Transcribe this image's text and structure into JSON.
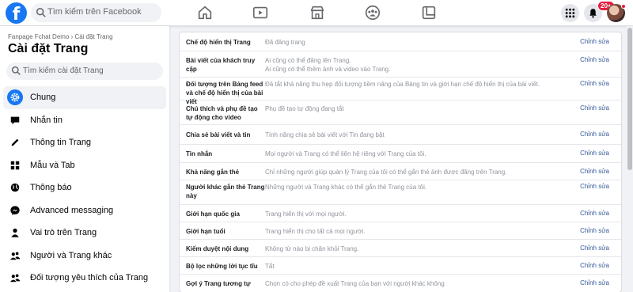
{
  "topbar": {
    "logo": "f",
    "search_placeholder": "Tìm kiếm trên Facebook",
    "nav_icons": [
      "home-icon",
      "watch-icon",
      "marketplace-icon",
      "groups-icon",
      "gaming-icon"
    ],
    "right_icons": [
      "menu-grid-icon",
      "notifications-icon"
    ],
    "notif_badge": "20+"
  },
  "sidebar": {
    "breadcrumb": "Fanpage Fchat Demo › Cài đặt Trang",
    "title": "Cài đặt Trang",
    "search_placeholder": "Tìm kiếm cài đặt Trang",
    "items": [
      {
        "label": "Chung",
        "icon": "gear-icon",
        "active": true
      },
      {
        "label": "Nhắn tin",
        "icon": "chat-icon"
      },
      {
        "label": "Thông tin Trang",
        "icon": "pencil-icon"
      },
      {
        "label": "Mẫu và Tab",
        "icon": "grid-icon"
      },
      {
        "label": "Thông báo",
        "icon": "globe-icon"
      },
      {
        "label": "Advanced messaging",
        "icon": "messenger-icon"
      },
      {
        "label": "Vai trò trên Trang",
        "icon": "person-icon"
      },
      {
        "label": "Người và Trang khác",
        "icon": "people-icon"
      },
      {
        "label": "Đối tượng yêu thích của Trang",
        "icon": "people-icon"
      }
    ]
  },
  "settings": {
    "edit_label": "Chỉnh sửa",
    "rows": [
      {
        "label": "Chế độ hiển thị Trang",
        "value": "Đã đăng trang"
      },
      {
        "label": "Bài viết của khách truy cập",
        "value": "Ai cũng có thể đăng lên Trang.\nAi cũng có thể thêm ảnh và video vào Trang."
      },
      {
        "label": "Đối tượng trên Bảng feed và chế độ hiển thị của bài viết",
        "value": "Đã tắt khả năng thu hẹp đối tượng tiềm năng của Bảng tin và giới hạn chế độ hiển thị của bài viết."
      },
      {
        "label": "Chú thích và phụ đề tạo tự động cho video",
        "value": "Phụ đề tạo tự động đang tắt"
      },
      {
        "label": "Chia sẻ bài viết và tin",
        "value": "Tính năng chia sẻ bài viết với Tin đang bật"
      },
      {
        "label": "Tin nhắn",
        "value": "Mọi người và Trang có thể liên hệ riêng với Trang của tôi."
      },
      {
        "label": "Khả năng gắn thẻ",
        "value": "Chỉ những người giúp quản lý Trang của tôi có thể gắn thẻ ảnh được đăng trên Trang."
      },
      {
        "label": "Người khác gắn thẻ Trang này",
        "value": "Những người và Trang khác có thể gắn thẻ Trang của tôi."
      },
      {
        "label": "Giới hạn quốc gia",
        "value": "Trang hiển thị với mọi người."
      },
      {
        "label": "Giới hạn tuổi",
        "value": "Trang hiển thị cho tất cả mọi người."
      },
      {
        "label": "Kiểm duyệt nội dung",
        "value": "Không từ nào bị chặn khỏi Trang."
      },
      {
        "label": "Bộ lọc những lời tục tĩu",
        "value": "Tắt"
      },
      {
        "label": "Gợi ý Trang tương tự",
        "value": "Chọn có cho phép đề xuất Trang của bạn với người khác không"
      }
    ]
  }
}
